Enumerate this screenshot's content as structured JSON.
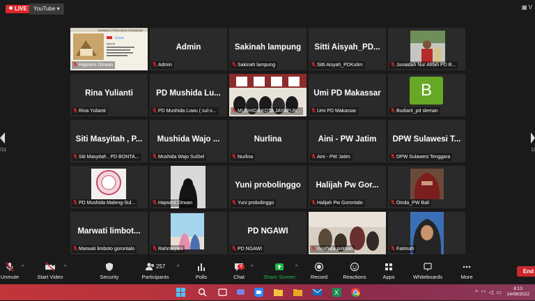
{
  "topbar": {
    "live": "LIVE",
    "youtube": "YouTube",
    "view": "V"
  },
  "pager": {
    "left_text": "/11",
    "right_text": "1/"
  },
  "tiles": [
    {
      "kind": "shared",
      "label": "Hapseni Dirwan",
      "active": true
    },
    {
      "kind": "name",
      "name": "Admin",
      "label": "Admin"
    },
    {
      "kind": "name",
      "name": "Sakinah lampung",
      "label": "Sakinah lampung"
    },
    {
      "kind": "name",
      "name": "Sitti Aisyah_PD...",
      "label": "Sitti Aisyah_PDKutim"
    },
    {
      "kind": "photo-outdoor",
      "label": "Junaidah Nur Afifah PD B..."
    },
    {
      "kind": "name",
      "name": "Rina Yulianti",
      "label": "Rina Yulianti"
    },
    {
      "kind": "name",
      "name": "PD Mushida Lu...",
      "label": "PD Mushida Luwu ( sul-s..."
    },
    {
      "kind": "photo-room",
      "label": "MUSHIDA KOTA JAYAPUR..."
    },
    {
      "kind": "name",
      "name": "Umi PD Makassar",
      "label": "Umi PD Makassar"
    },
    {
      "kind": "avatar",
      "letter": "B",
      "label": "Budiarti_pd sleman"
    },
    {
      "kind": "name",
      "name": "Siti Masyitah , P...",
      "label": "Siti Masyitah , PD BONTA..."
    },
    {
      "kind": "name",
      "name": "Mushida Wajo ...",
      "label": "Mushida Wajo SulSel"
    },
    {
      "kind": "name",
      "name": "Nurlina",
      "label": "Nurlina"
    },
    {
      "kind": "name",
      "name": "Aini - PW Jatim",
      "label": "Aini - PW Jatim"
    },
    {
      "kind": "name",
      "name": "DPW Sulawesi T...",
      "label": "DPW Sulawesi Tenggara"
    },
    {
      "kind": "photo-logo",
      "label": "PD Mushida Maleng-Sul..."
    },
    {
      "kind": "photo-veil",
      "label": "Hapseni Dirwan"
    },
    {
      "kind": "name",
      "name": "Yuni probolinggo",
      "label": "Yuni probolinggo"
    },
    {
      "kind": "name",
      "name": "Halijah  Pw Gor...",
      "label": "Halijah  Pw Gorontalo"
    },
    {
      "kind": "photo-red",
      "label": "Dinda_PW Bali"
    },
    {
      "kind": "name",
      "name": "Marwati  limbot...",
      "label": "Marwati limboto gorontalo"
    },
    {
      "kind": "photo-sky",
      "label": "Rahmayani"
    },
    {
      "kind": "name",
      "name": "PD NGAWI",
      "label": "PD NGAWI"
    },
    {
      "kind": "photo-group",
      "label": "mushida polman"
    },
    {
      "kind": "photo-hijab",
      "label": "Fatimah"
    }
  ],
  "shared_screen": {
    "line1": "SEMINAR & PENGUATAN ORGANISASI",
    "line2": "Zoom",
    "line3": "Agenda"
  },
  "toolbar": {
    "unmute": "Unmute",
    "start_video": "Start Video",
    "security": "Security",
    "participants": "Participants",
    "participants_count": "257",
    "polls": "Polls",
    "chat": "Chat",
    "chat_badge": "4",
    "share_screen": "Share Screen",
    "record": "Record",
    "reactions": "Reactions",
    "apps": "Apps",
    "whiteboards": "Whiteboards",
    "more": "More",
    "end": "End"
  },
  "taskbar": {
    "time": "8:13",
    "date": "14/08/2022"
  },
  "colors": {
    "active_border": "#9bd21d",
    "share_green": "#1fb84a",
    "end_red": "#c9282d",
    "live_red": "#e0262b"
  }
}
